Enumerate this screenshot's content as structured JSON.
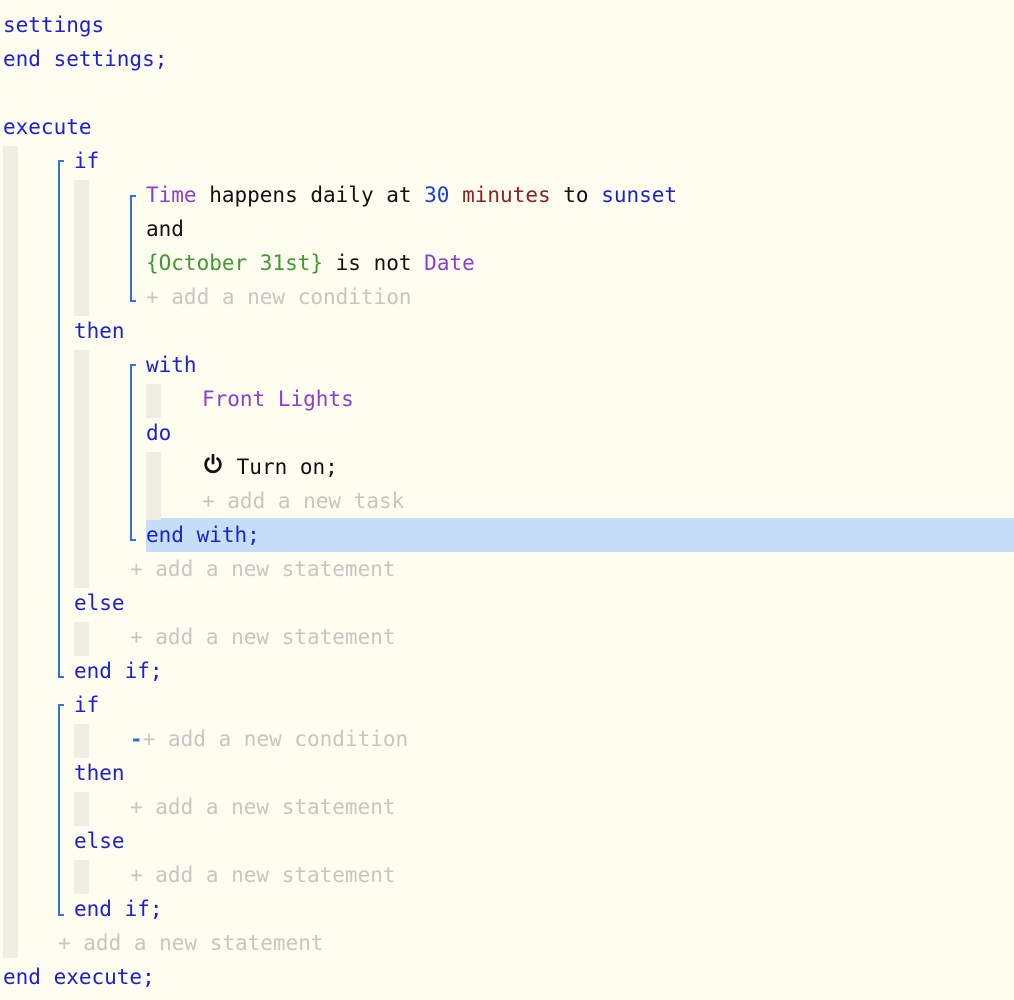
{
  "code": {
    "settings": "settings",
    "end_settings": "end settings;",
    "execute": "execute",
    "if1": "if",
    "cond_time_var": "Time",
    "cond_happens": " happens daily at ",
    "cond_num": "30",
    "cond_unit": "minutes",
    "cond_to": " to ",
    "cond_sunset": "sunset",
    "and": "and",
    "cond_date_literal": "{October 31st}",
    "cond_is_not": " is not ",
    "cond_date_var": "Date",
    "add_condition": "+ add a new condition",
    "then1": "then",
    "with": "with",
    "device": "Front Lights",
    "do": "do",
    "task_turn_on": "Turn on;",
    "add_task": "+ add a new task",
    "end_with": "end with;",
    "add_statement": "+ add a new statement",
    "else1": "else",
    "end_if": "end if;",
    "if2": "if",
    "minus": "-",
    "then2": "then",
    "else2": "else",
    "end_execute": "end execute;"
  },
  "icons": {
    "power": "power-icon"
  },
  "colors": {
    "keyword": "#1a22d0",
    "variable": "#8a3fd0",
    "number": "#1a40d8",
    "unit": "#8a2222",
    "literal": "#3e9a2e",
    "placeholder": "#c7c6c0",
    "selection": "#c6def7",
    "background": "#fffcf0"
  }
}
